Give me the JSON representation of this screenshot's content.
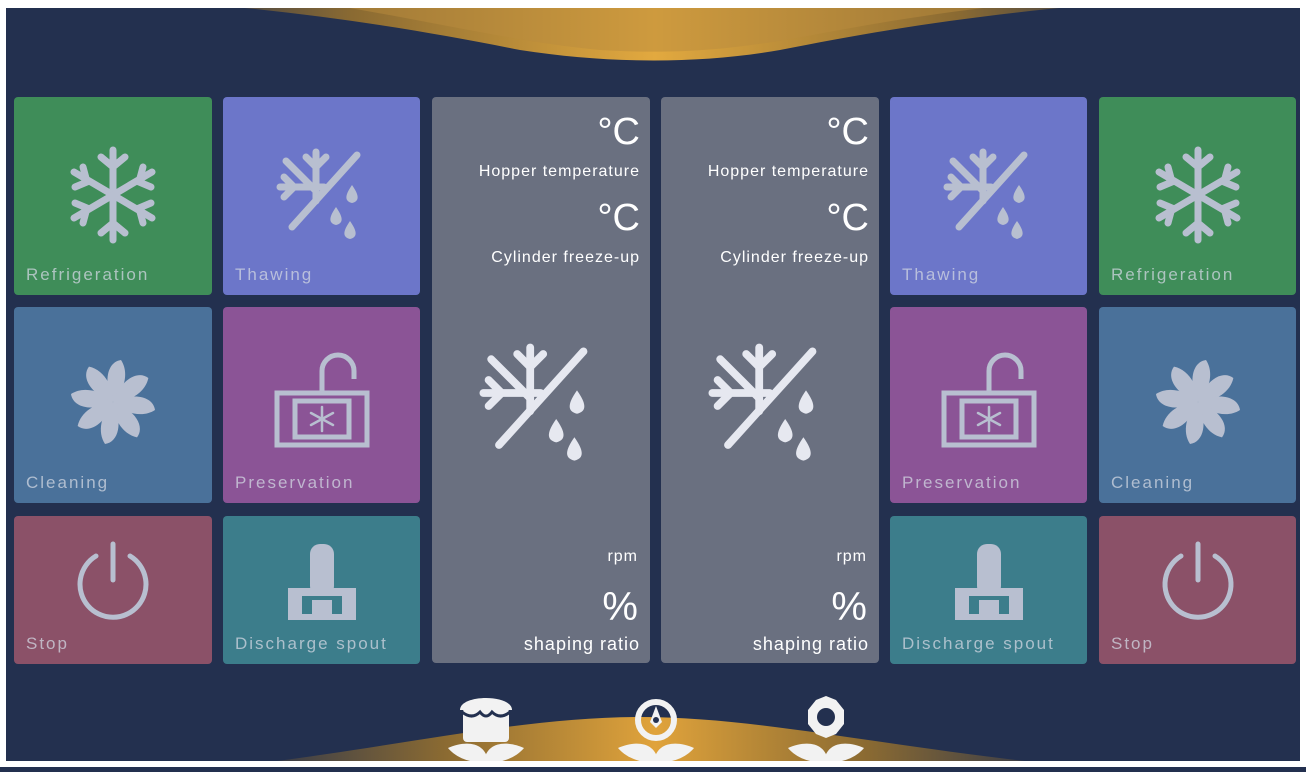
{
  "colors": {
    "background": "#23304f",
    "green": "#3f8d59",
    "violet": "#6c76c9",
    "blue": "#4a719a",
    "purple": "#8b5496",
    "red": "#8b5168",
    "teal": "#3c7d8b",
    "panel": "#6a7080",
    "gold": "#d9a23c"
  },
  "left": {
    "refrigeration": {
      "label": "Refrigeration",
      "icon": "snowflake-icon"
    },
    "thawing": {
      "label": "Thawing",
      "icon": "thaw-icon"
    },
    "cleaning": {
      "label": "Cleaning",
      "icon": "pinwheel-icon"
    },
    "preservation": {
      "label": "Preservation",
      "icon": "unlock-box-icon"
    },
    "stop": {
      "label": "Stop",
      "icon": "power-icon"
    },
    "discharge": {
      "label": "Discharge spout",
      "icon": "spout-icon"
    }
  },
  "right": {
    "thawing": {
      "label": "Thawing",
      "icon": "thaw-icon"
    },
    "refrigeration": {
      "label": "Refrigeration",
      "icon": "snowflake-icon"
    },
    "preservation": {
      "label": "Preservation",
      "icon": "unlock-box-icon"
    },
    "cleaning": {
      "label": "Cleaning",
      "icon": "pinwheel-icon"
    },
    "discharge": {
      "label": "Discharge spout",
      "icon": "spout-icon"
    },
    "stop": {
      "label": "Stop",
      "icon": "power-icon"
    }
  },
  "panels": [
    {
      "hopper_unit": "°C",
      "hopper_label": "Hopper temperature",
      "cylinder_unit": "°C",
      "cylinder_label": "Cylinder freeze-up",
      "rpm_label": "rpm",
      "ratio_unit": "%",
      "ratio_label": "shaping ratio"
    },
    {
      "hopper_unit": "°C",
      "hopper_label": "Hopper temperature",
      "cylinder_unit": "°C",
      "cylinder_label": "Cylinder freeze-up",
      "rpm_label": "rpm",
      "ratio_unit": "%",
      "ratio_label": "shaping ratio"
    }
  ],
  "bottom_nav": [
    {
      "icon": "store-icon"
    },
    {
      "icon": "clock-icon"
    },
    {
      "icon": "settings-icon"
    }
  ]
}
